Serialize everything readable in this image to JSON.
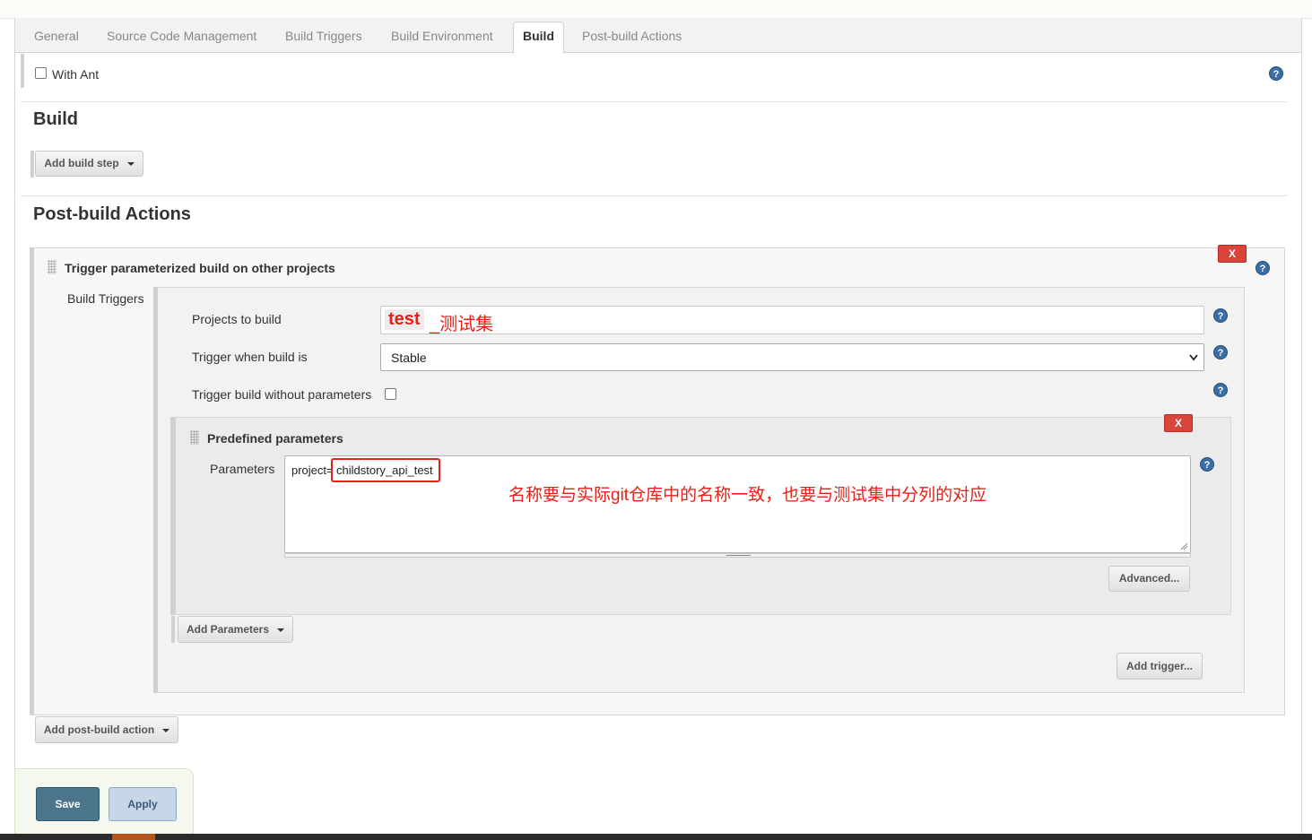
{
  "tabs": [
    "General",
    "Source Code Management",
    "Build Triggers",
    "Build Environment",
    "Build",
    "Post-build Actions"
  ],
  "active_tab": "Build",
  "build_env": {
    "with_ant_label": "With Ant"
  },
  "build": {
    "heading": "Build",
    "add_step": "Add build step"
  },
  "post_build": {
    "heading": "Post-build Actions",
    "trigger_title": "Trigger parameterized build on other projects",
    "build_triggers_label": "Build Triggers",
    "projects_label": "Projects to build",
    "projects_value_prefix": "test",
    "projects_value_suffix": "_测试集",
    "trigger_when_label": "Trigger when build is",
    "trigger_when_value": "Stable",
    "no_params_label": "Trigger build without parameters",
    "predefined_title": "Predefined parameters",
    "parameters_label": "Parameters",
    "parameters_prefix": "project=",
    "parameters_value": "childstory_api_test",
    "annotation": "名称要与实际git仓库中的名称一致，也要与测试集中分列的对应",
    "advanced": "Advanced...",
    "add_parameters": "Add Parameters",
    "add_trigger": "Add trigger...",
    "add_post_build": "Add post-build action",
    "remove_label": "X"
  },
  "actions": {
    "save": "Save",
    "apply": "Apply"
  },
  "help_glyph": "?",
  "colors": {
    "annotation_red": "#e62117",
    "save_bg": "#4b758b",
    "apply_bg": "#c8d7e8"
  }
}
